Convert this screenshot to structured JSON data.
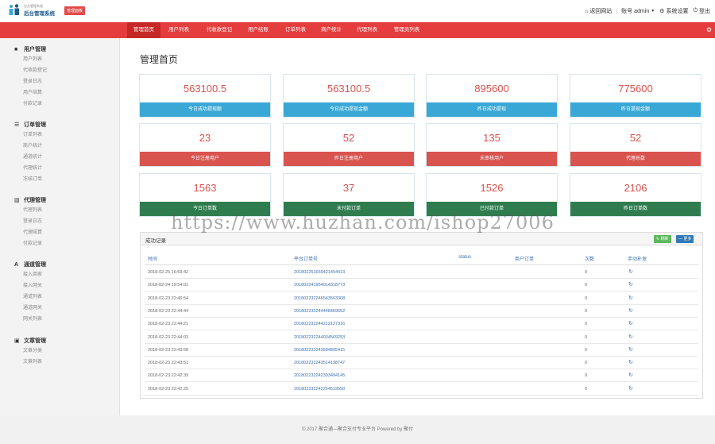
{
  "header": {
    "logo_small": "后台管理系统",
    "logo_main": "后台管理系统",
    "badge": "管理面板",
    "home_link": "返回网站",
    "account_prefix": "账号",
    "username": "admin",
    "settings": "系统设置",
    "logout": "登出"
  },
  "nav": {
    "tabs": [
      "管理首页",
      "用户列表",
      "代收款登记",
      "用户结账",
      "订单列表",
      "商户统计",
      "代理列表",
      "管理员列表"
    ]
  },
  "sidebar": {
    "groups": [
      {
        "title": "用户管理",
        "icon": "user-icon",
        "items": [
          "用户列表",
          "代收款登记",
          "登录日志",
          "用户结算",
          "付款记录"
        ]
      },
      {
        "title": "订单管理",
        "icon": "list-icon",
        "items": [
          "订单列表",
          "商户统计",
          "通道统计",
          "代理统计",
          "冻结订单"
        ]
      },
      {
        "title": "代理管理",
        "icon": "file-icon",
        "items": [
          "代理列表",
          "登录日志",
          "代理结算",
          "付款记录"
        ]
      },
      {
        "title": "通道管理",
        "icon": "font-icon",
        "items": [
          "接入商家",
          "接入网关",
          "通道列表",
          "通道网关",
          "网关列表"
        ]
      },
      {
        "title": "文章管理",
        "icon": "article-icon",
        "items": [
          "文章分类",
          "文章列表"
        ]
      }
    ]
  },
  "main": {
    "page_title": "管理首页",
    "cards": [
      {
        "value": "563100.5",
        "label": "今日成功提现额",
        "color": "blue"
      },
      {
        "value": "563100.5",
        "label": "今日成功提现金额",
        "color": "blue"
      },
      {
        "value": "895600",
        "label": "昨日成功提现",
        "color": "blue"
      },
      {
        "value": "775600",
        "label": "昨日提现金额",
        "color": "blue"
      },
      {
        "value": "23",
        "label": "今日注册用户",
        "color": "red"
      },
      {
        "value": "52",
        "label": "昨日注册用户",
        "color": "red"
      },
      {
        "value": "135",
        "label": "未审核用户",
        "color": "red"
      },
      {
        "value": "52",
        "label": "代理总数",
        "color": "red"
      },
      {
        "value": "1563",
        "label": "今日订单数",
        "color": "green"
      },
      {
        "value": "37",
        "label": "未付款订单",
        "color": "green"
      },
      {
        "value": "1526",
        "label": "已付款订单",
        "color": "green"
      },
      {
        "value": "2106",
        "label": "昨日订单数",
        "color": "green"
      }
    ]
  },
  "table": {
    "title": "成功记录",
    "btn_refresh": "刷新",
    "btn_more": "更多",
    "columns": [
      "时间",
      "平台订单号",
      "status",
      "商户订单",
      "次数",
      "手动补发"
    ],
    "rows": [
      {
        "time": "2018-02-25 16:59:42",
        "order": "201802251659421454413",
        "count": "0"
      },
      {
        "time": "2018-02-24 19:54:01",
        "order": "201802241954014318773",
        "count": "0"
      },
      {
        "time": "2018-02-23 22:46:54",
        "order": "201802232246543563308",
        "count": "0"
      },
      {
        "time": "2018-02-23 22:44:44",
        "order": "201802232244448469652",
        "count": "0"
      },
      {
        "time": "2018-02-23 22:44:21",
        "order": "201802232244212127316",
        "count": "0"
      },
      {
        "time": "2018-02-23 22:44:03",
        "order": "201802232244034569253",
        "count": "0"
      },
      {
        "time": "2018-02-23 22:43:58",
        "order": "201802232243584895415",
        "count": "0"
      },
      {
        "time": "2018-02-23 22:43:51",
        "order": "201802232243514198747",
        "count": "0"
      },
      {
        "time": "2018-02-23 22:42:39",
        "order": "201802232242393494145",
        "count": "0"
      },
      {
        "time": "2018-02-23 22:42:25",
        "order": "201802232242254519550",
        "count": "0"
      }
    ]
  },
  "footer": {
    "text": "© 2017 聚合通—聚合支付专业平台 Powered by 聚付"
  },
  "watermark": "https://www.huzhan.com/ishop27006",
  "colors": {
    "nav_red": "#e53d3d",
    "card_blue": "#3aa8d6",
    "card_red": "#d9534f",
    "card_green": "#2f7d4e"
  }
}
